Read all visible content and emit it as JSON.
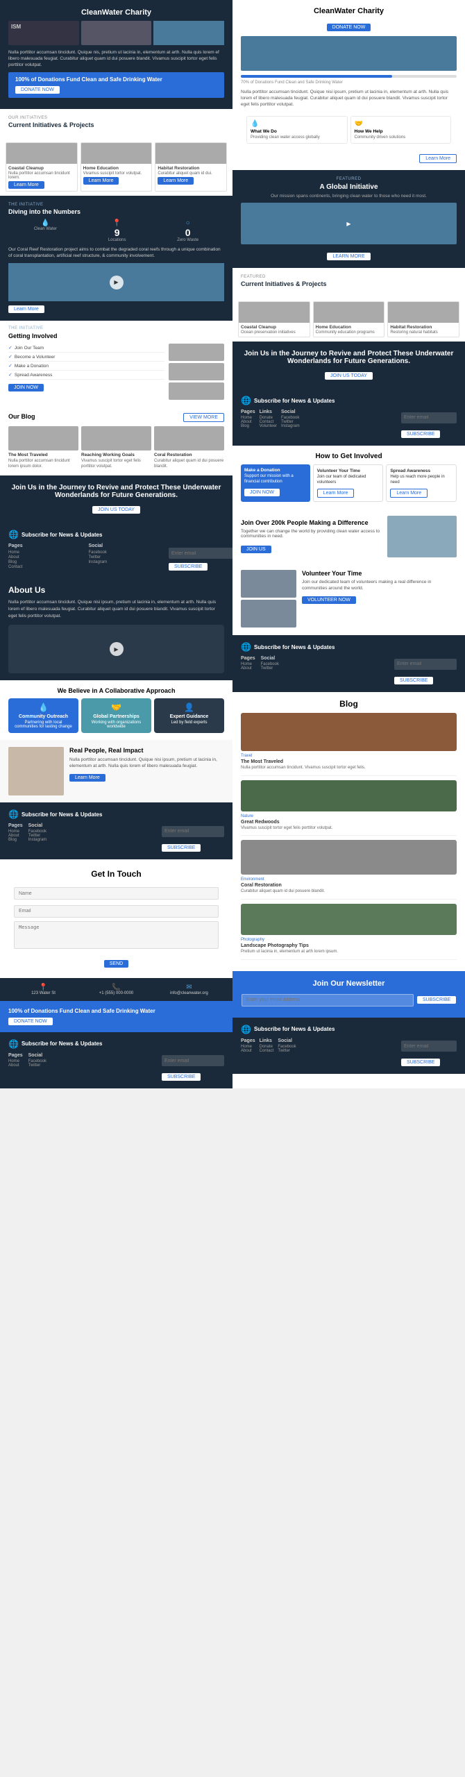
{
  "site": {
    "name": "CleanWater Charity"
  },
  "left": {
    "hero": {
      "title": "CleanWater Charity",
      "card1": {
        "label": "ISM",
        "text": "Nulla porttitor accumsan tincidunt. Quique nis, pretium ut lacinia in, elementum at arth. Nulla quis lorem ef libero malesuada feugiat. Curabitur aliquet quam id dui posuere blandit. Vivamus suscipit tortor eget felis porttitor volutpat."
      },
      "banner": {
        "title": "100% of Donations Fund Clean and Safe Drinking Water",
        "button": "DONATE NOW"
      }
    },
    "initiatives": {
      "label": "OUR INITIATIVES",
      "title": "Current Initiatives & Projects",
      "cards": [
        {
          "name": "Coastal Cleanup",
          "color": "bg-ocean"
        },
        {
          "name": "Home Education",
          "color": "bg-forest"
        },
        {
          "name": "Habitat Restoration",
          "color": "bg-autumn"
        }
      ]
    },
    "stats": {
      "title": "Diving into the Numbers",
      "items": [
        {
          "icon": "💧",
          "num": "",
          "label": "Clean Water Access"
        },
        {
          "icon": "📍",
          "num": "9",
          "label": "Locations"
        },
        {
          "icon": "○",
          "num": "0",
          "label": "Zero Waste"
        }
      ],
      "description": "Our Coral Reef Restoration project aims to combat the degraded coral reefs through a unique combination of coral transplantation, artificial reef structure, & community involvement."
    },
    "getting_involved": {
      "title": "Getting Involved",
      "items": [
        "Join Our Team",
        "Become a Volunteer",
        "Make a Donation",
        "Spread Awareness"
      ],
      "button": "JOIN NOW"
    },
    "blog": {
      "title": "Our Blog",
      "button": "VIEW MORE",
      "posts": [
        {
          "title": "The Most Traveled",
          "color": "bg-forest"
        },
        {
          "title": "Reaching Working Goals",
          "color": "bg-sand"
        },
        {
          "title": "Coral Restoration",
          "color": "bg-ocean"
        }
      ]
    },
    "journey": {
      "title": "Join Us in the Journey to Revive and Protect These Underwater Wonderlands for Future Generations.",
      "button": "JOIN US TODAY"
    },
    "subscribe1": {
      "title": "Subscribe for News & Updates",
      "cols": [
        {
          "heading": "Pages",
          "links": [
            "Home",
            "About",
            "Blog",
            "Contact"
          ]
        },
        {
          "heading": "Social",
          "links": [
            "Facebook",
            "Twitter",
            "Instagram"
          ]
        }
      ],
      "placeholder": "Enter your email",
      "button": "SUBSCRIBE"
    },
    "about": {
      "title": "About Us",
      "text": "Nulla porttitor accumsan tincidunt. Quique nisi ipsum, pretium ut lacinia in, elementum at arth. Nulla quis lorem ef libero malesuada feugiat. Curabitur aliquet quam id dui posuere blandit. Vivamus suscipit tortor eget felis porttitor volutpat."
    },
    "collab": {
      "title": "We Believe in A Collaborative Approach",
      "cards": [
        {
          "icon": "💧",
          "title": "Community Outreach",
          "text": "Partnering with local communities"
        },
        {
          "icon": "🤝",
          "title": "Global Partnerships",
          "text": "Working with organizations worldwide"
        },
        {
          "icon": "👤",
          "title": "Expert Guidance",
          "text": "Led by field experts"
        }
      ]
    },
    "real_people": {
      "title": "Real People, Real Impact",
      "text": "Nulla porttitor accumsan tincidunt. Quique nisi ipsum, pretium ut lacinia in, elementum at arth. Nulla quis lorem ef libero malesuada feugiat."
    },
    "subscribe2": {
      "title": "Subscribe for News & Updates",
      "placeholder": "Enter your email",
      "button": "SUBSCRIBE"
    },
    "contact": {
      "title": "Get In Touch",
      "fields": [
        {
          "placeholder": "Name",
          "type": "text"
        },
        {
          "placeholder": "Email",
          "type": "email"
        },
        {
          "placeholder": "Message",
          "type": "textarea"
        }
      ],
      "button": "SEND"
    },
    "contact_info": [
      {
        "icon": "📍",
        "text": "123 Water St, Ocean City"
      },
      {
        "icon": "📞",
        "text": "+1 (555) 000-0000"
      },
      {
        "icon": "✉",
        "text": "info@cleanwater.org"
      }
    ],
    "donate_banner": {
      "title": "100% of Donations Fund Clean and Safe Drinking Water",
      "button": "DONATE NOW"
    },
    "subscribe3": {
      "title": "Subscribe for News & Updates",
      "placeholder": "Enter your email",
      "button": "SUBSCRIBE"
    }
  },
  "right": {
    "hero": {
      "title": "CleanWater Charity",
      "button": "DONATE NOW",
      "progress_label": "70% of Donations Fund Clean and Safe Drinking Water",
      "progress_value": 70,
      "text": "Nulla porttitor accumsan tincidunt. Quique nisi ipsum, pretium ut lacinia in, elementum at arth. Nulla quis lorem ef libero malesuada feugiat. Curabitur aliquet quam id dui posuere blandit. Vivamus suscipit tortor eget felis porttitor volutpat.",
      "button2": "Learn More",
      "features": [
        {
          "icon": "💧",
          "title": "What We Do",
          "text": "Providing clean water access globally"
        },
        {
          "icon": "🤝",
          "title": "How We Help",
          "text": "Community driven solutions"
        }
      ]
    },
    "global": {
      "label": "FEATURED",
      "title": "A Global Initiative",
      "text": "Our mission spans continents, bringing clean water to those who need it most.",
      "button": "LEARN MORE"
    },
    "initiatives": {
      "label": "FEATURED",
      "title": "Current Initiatives & Projects",
      "cards": [
        {
          "name": "Coastal Cleanup",
          "color": "bg-ocean"
        },
        {
          "name": "Home Education",
          "color": "bg-forest"
        },
        {
          "name": "Habitat Restoration",
          "color": "bg-autumn"
        }
      ]
    },
    "journey2": {
      "title": "Join Us in the Journey to Revive and Protect These Underwater Wonderlands for Future Generations.",
      "button": "JOIN US TODAY"
    },
    "subscribe1": {
      "title": "Subscribe for News & Updates",
      "cols": [
        {
          "heading": "Pages",
          "links": [
            "Home",
            "About",
            "Blog"
          ]
        },
        {
          "heading": "Links",
          "links": [
            "Donate",
            "Contact",
            "Volunteer"
          ]
        },
        {
          "heading": "Social",
          "links": [
            "Facebook",
            "Twitter",
            "Instagram"
          ]
        }
      ],
      "placeholder": "Enter your email",
      "button": "SUBSCRIBE"
    },
    "how": {
      "title": "How to Get Involved",
      "cards": [
        {
          "style": "filled",
          "title": "Make a Donation",
          "text": "Support our mission with a financial contribution"
        },
        {
          "style": "outline",
          "title": "Volunteer Your Time",
          "text": "Join our team of dedicated volunteers"
        },
        {
          "style": "outline",
          "title": "Spread Awareness",
          "text": "Help us reach more people in need"
        }
      ],
      "button": "JOIN NOW"
    },
    "join200": {
      "title": "Join Over 200k People Making a Difference",
      "text": "Together we can change the world by providing clean water access to communities in need.",
      "button": "JOIN US"
    },
    "volunteer": {
      "title": "Volunteer Your Time",
      "text": "Join our dedicated team of volunteers making a real difference in communities around the world.",
      "button": "VOLUNTEER NOW"
    },
    "subscribe2": {
      "title": "Subscribe for News & Updates",
      "placeholder": "Enter your email",
      "button": "SUBSCRIBE"
    },
    "blog": {
      "title": "Blog",
      "articles": [
        {
          "title": "The Most Traveled",
          "tag": "Travel",
          "text": "Nulla porttitor accumsan tincidunt...",
          "color": "bg-autumn"
        },
        {
          "title": "Great Redwoods",
          "tag": "Nature",
          "text": "Vivamus suscipit tortor eget felis porttitor volutpat.",
          "color": "bg-forest"
        },
        {
          "title": "Coral Restoration",
          "tag": "Environment",
          "text": "Curabitur aliquet quam id dui posuere blandit.",
          "color": "bg-ocean"
        },
        {
          "title": "Landscape Photography Tips",
          "tag": "Photography",
          "text": "Pretium ut lacinia in, elementum at arth.",
          "color": "bg-stone"
        }
      ]
    },
    "newsletter": {
      "title": "Join Our Newsletter",
      "placeholder": "Enter your email address",
      "button": "SUBSCRIBE"
    },
    "subscribe3": {
      "title": "Subscribe for News & Updates",
      "placeholder": "Enter your email",
      "button": "SUBSCRIBE"
    }
  }
}
